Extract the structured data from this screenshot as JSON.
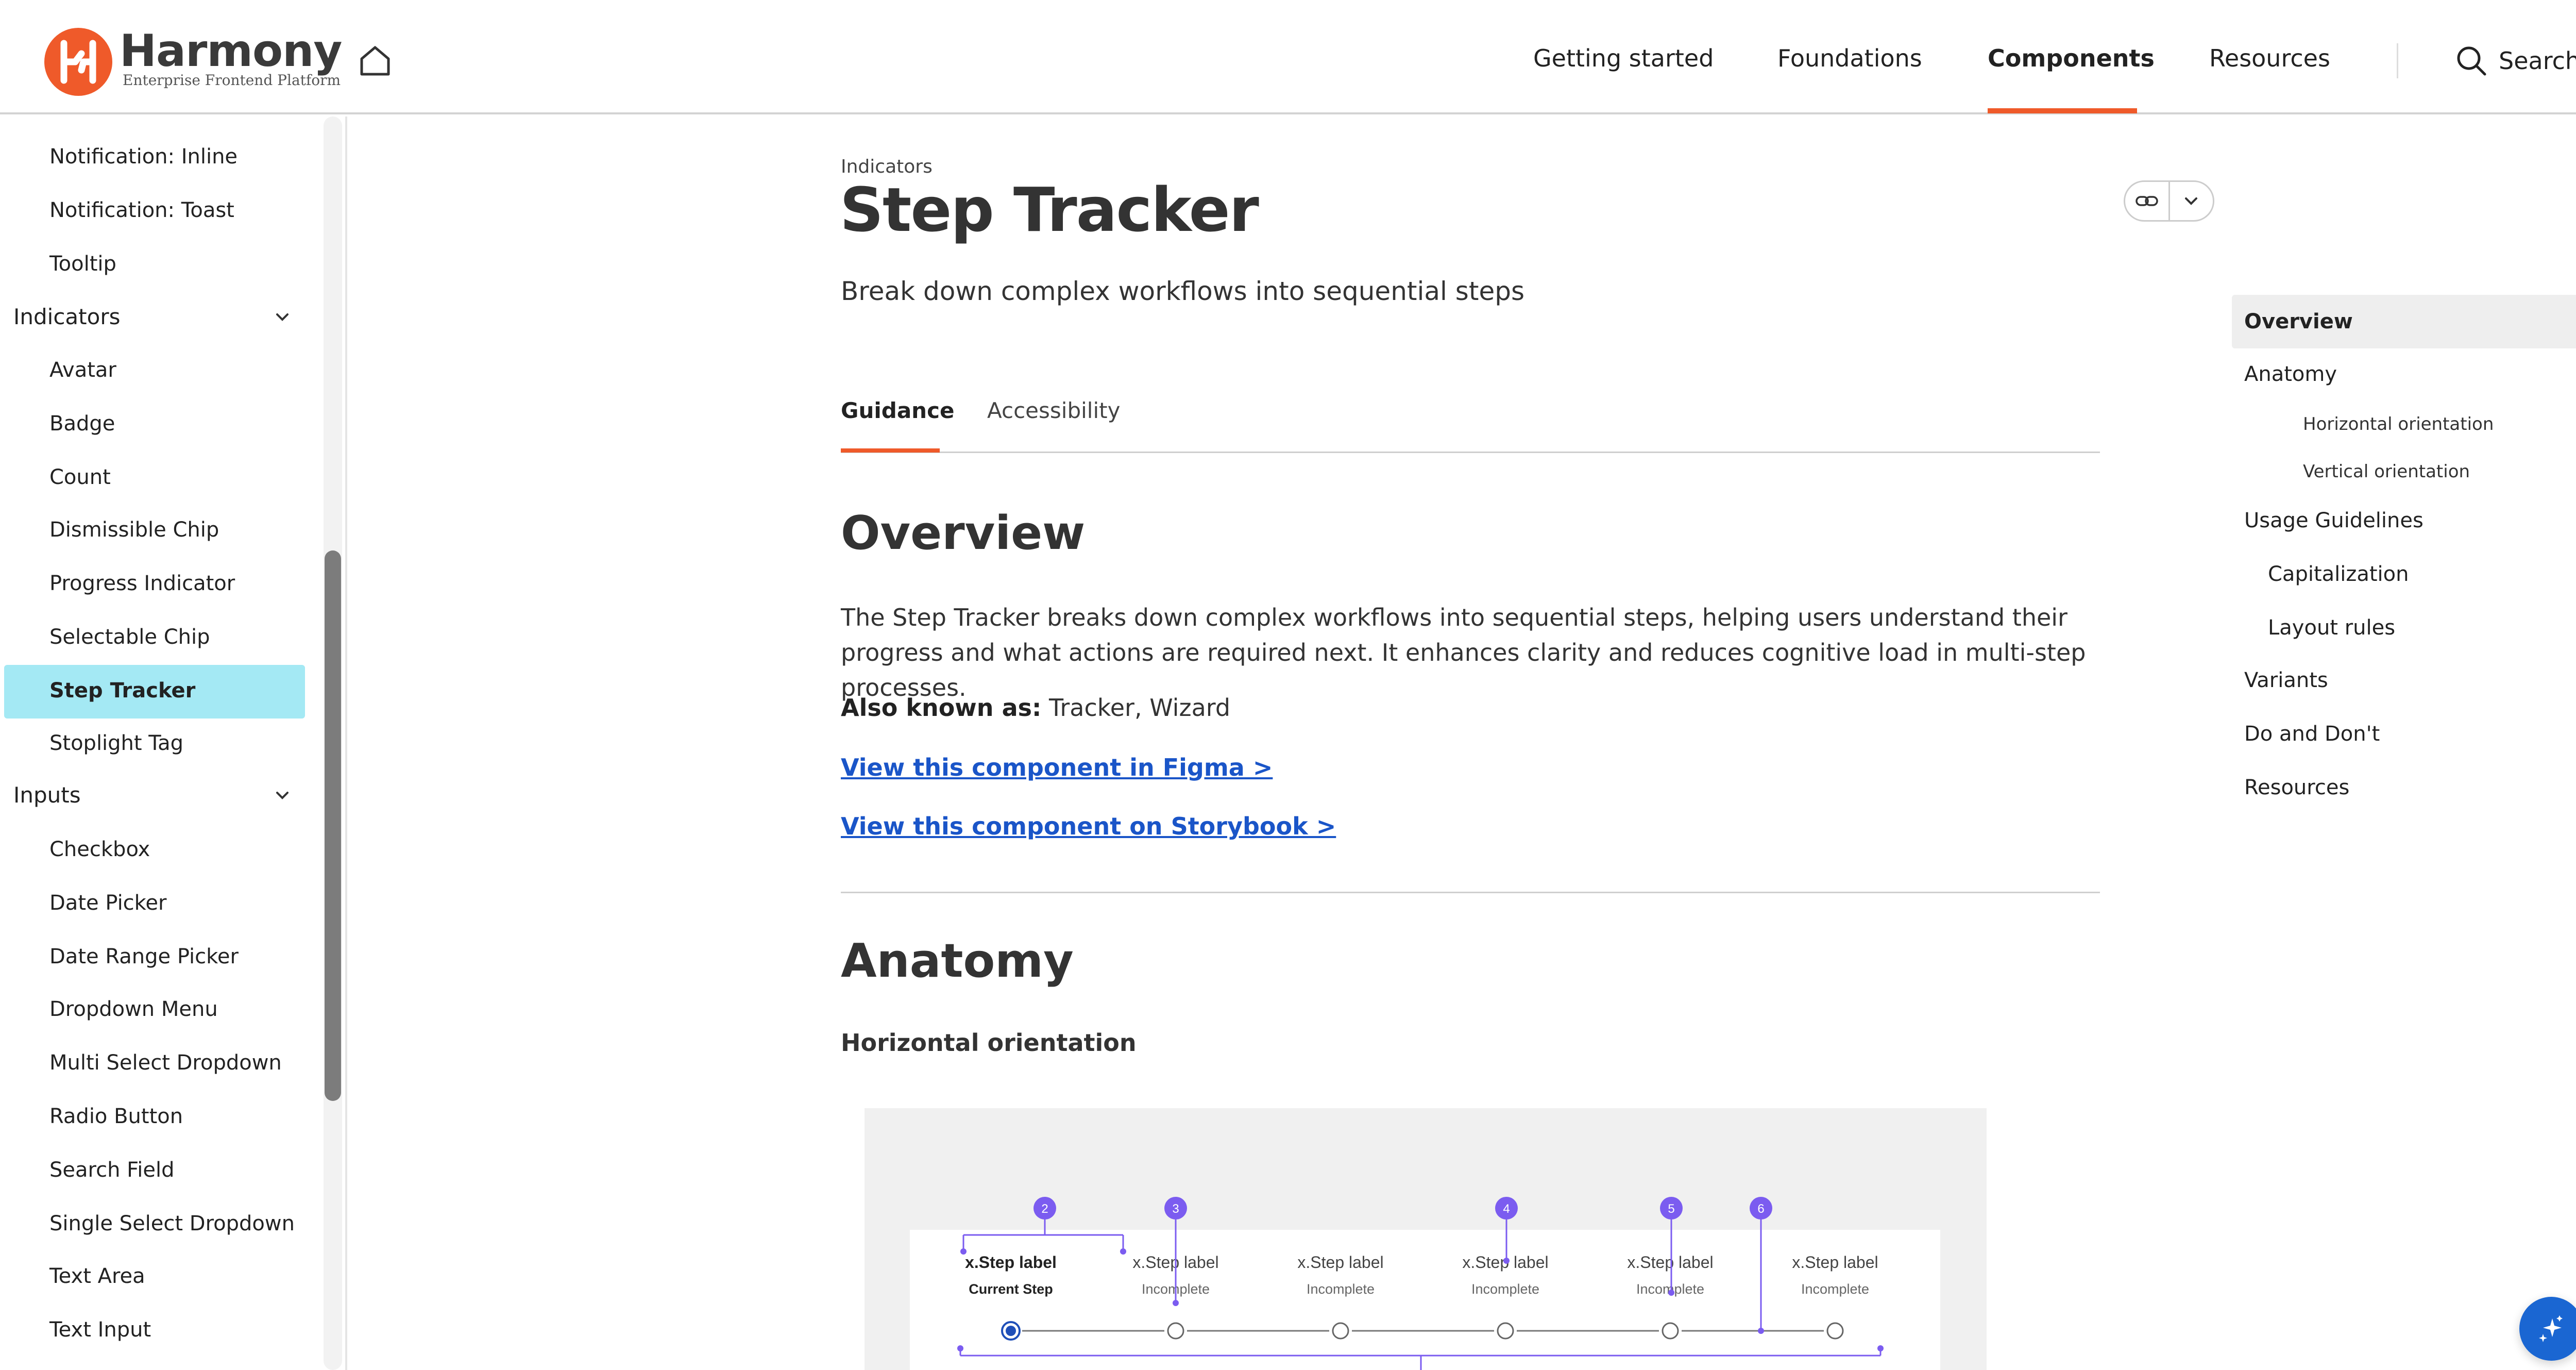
{
  "brand": {
    "name": "Harmony",
    "tagline": "Enterprise Frontend Platform",
    "accent": "#ef5a2a",
    "link_color": "#1a55c8",
    "highlight": "#a4e9f4"
  },
  "header": {
    "nav": [
      "Getting started",
      "Foundations",
      "Components",
      "Resources"
    ],
    "active_nav": "Components",
    "search_label": "Search"
  },
  "sidebar": {
    "items_top": [
      "Notification: Inline",
      "Notification: Toast",
      "Tooltip"
    ],
    "group_indicators": "Indicators",
    "indicators": [
      "Avatar",
      "Badge",
      "Count",
      "Dismissible Chip",
      "Progress Indicator",
      "Selectable Chip",
      "Step Tracker",
      "Stoplight Tag"
    ],
    "active_item": "Step Tracker",
    "group_inputs": "Inputs",
    "inputs": [
      "Checkbox",
      "Date Picker",
      "Date Range Picker",
      "Dropdown Menu",
      "Multi Select Dropdown",
      "Radio Button",
      "Search Field",
      "Single Select Dropdown",
      "Text Area",
      "Text Input"
    ]
  },
  "main": {
    "breadcrumb": "Indicators",
    "title": "Step Tracker",
    "subtitle": "Break down complex workflows into sequential steps",
    "tabs": [
      "Guidance",
      "Accessibility"
    ],
    "active_tab": "Guidance",
    "overview_heading": "Overview",
    "overview_text": "The Step Tracker breaks down complex workflows into sequential steps, helping users understand their progress and what actions are required next. It enhances clarity and reduces cognitive load in multi-step processes.",
    "aka_label": "Also known as:",
    "aka_value": "Tracker, Wizard",
    "figma_link": "View this component in Figma >",
    "storybook_link": "View this component on Storybook >",
    "anatomy_heading": "Anatomy",
    "horizontal_heading": "Horizontal orientation"
  },
  "diagram": {
    "steps": [
      {
        "label": "x.Step label",
        "status": "Current Step",
        "current": true
      },
      {
        "label": "x.Step label",
        "status": "Incomplete",
        "current": false
      },
      {
        "label": "x.Step label",
        "status": "Incomplete",
        "current": false
      },
      {
        "label": "x.Step label",
        "status": "Incomplete",
        "current": false
      },
      {
        "label": "x.Step label",
        "status": "Incomplete",
        "current": false
      },
      {
        "label": "x.Step label",
        "status": "Incomplete",
        "current": false
      }
    ],
    "markers": [
      "2",
      "3",
      "4",
      "5",
      "6"
    ],
    "marker_color": "#7b5cf0"
  },
  "toc": {
    "items": [
      {
        "label": "Overview",
        "level": 1,
        "active": true
      },
      {
        "label": "Anatomy",
        "level": 1
      },
      {
        "label": "Horizontal orientation",
        "level": 3
      },
      {
        "label": "Vertical orientation",
        "level": 3
      },
      {
        "label": "Usage Guidelines",
        "level": 1
      },
      {
        "label": "Capitalization",
        "level": 2
      },
      {
        "label": "Layout rules",
        "level": 2
      },
      {
        "label": "Variants",
        "level": 1
      },
      {
        "label": "Do and Don't",
        "level": 1
      },
      {
        "label": "Resources",
        "level": 1
      }
    ]
  },
  "icons": [
    "harmony-logo-icon",
    "home-icon",
    "search-icon",
    "chevron-down-icon",
    "link-icon",
    "ai-sparkle-icon"
  ]
}
